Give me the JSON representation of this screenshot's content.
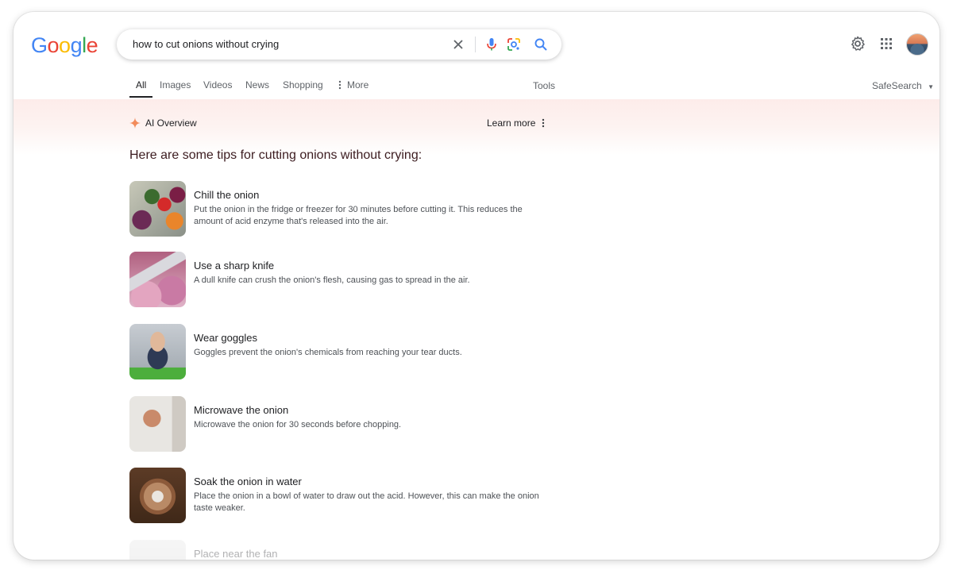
{
  "logo": {
    "text": "Google"
  },
  "search": {
    "query": "how to cut onions without crying"
  },
  "icons": {
    "clear": "close-icon",
    "mic": "microphone-icon",
    "lens": "camera-lens-icon",
    "search": "search-icon",
    "settings": "gear-icon",
    "apps": "apps-grid-icon",
    "more": "more-vert-icon",
    "ai": "sparkle-icon"
  },
  "tabs": [
    {
      "label": "All"
    },
    {
      "label": "Images"
    },
    {
      "label": "Videos"
    },
    {
      "label": "News"
    },
    {
      "label": "Shopping"
    },
    {
      "label": "More"
    }
  ],
  "tools_label": "Tools",
  "safesearch_label": "SafeSearch",
  "ai_overview": {
    "label": "AI Overview",
    "learn_more": "Learn more",
    "heading": "Here are some tips for cutting onions without crying:",
    "tips": [
      {
        "title": "Chill the onion",
        "desc": "Put the onion in the fridge or freezer for 30 minutes before cutting it. This reduces the amount of acid enzyme that's released into the air."
      },
      {
        "title": "Use a sharp knife",
        "desc": "A dull knife can crush the onion's flesh, causing gas to spread in the air."
      },
      {
        "title": "Wear goggles",
        "desc": "Goggles prevent the onion's chemicals from reaching your tear ducts."
      },
      {
        "title": "Microwave the onion",
        "desc": "Microwave the onion for 30 seconds before chopping."
      },
      {
        "title": "Soak the onion in water",
        "desc": "Place the onion in a bowl of water to draw out the acid. However, this can make the onion taste weaker."
      },
      {
        "title": "Place near the fan",
        "desc": ""
      }
    ]
  },
  "colors": {
    "blue": "#4285f4",
    "red": "#ea4335",
    "yellow": "#fbbc05",
    "green": "#34a853",
    "accent": "#f28b5a"
  }
}
